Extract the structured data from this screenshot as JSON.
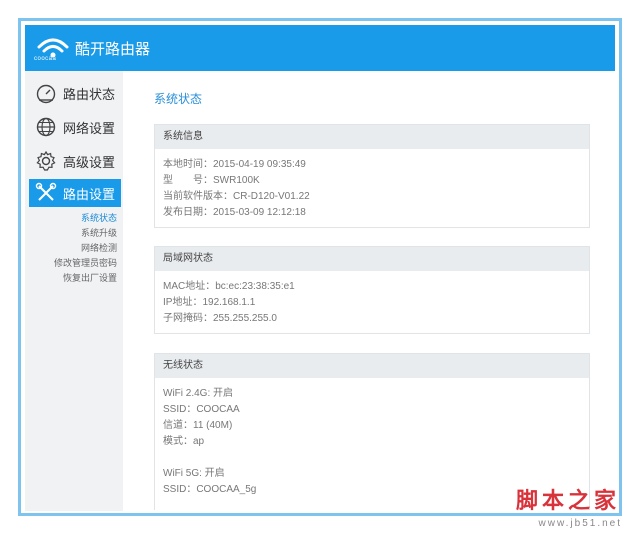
{
  "header": {
    "app_title": "酷开路由器",
    "logo_text": "coocaa"
  },
  "sidebar": {
    "items": [
      {
        "label": "路由状态",
        "icon": "gauge-icon"
      },
      {
        "label": "网络设置",
        "icon": "globe-icon"
      },
      {
        "label": "高级设置",
        "icon": "gear-icon"
      },
      {
        "label": "路由设置",
        "icon": "tools-icon"
      }
    ],
    "sub_items": [
      "系统状态",
      "系统升级",
      "网络检测",
      "修改管理员密码",
      "恢复出厂设置"
    ]
  },
  "main": {
    "page_title": "系统状态",
    "panels": [
      {
        "title": "系统信息",
        "lines": [
          "本地时间：2015-04-19 09:35:49",
          "型　　号：SWR100K",
          "当前软件版本：CR-D120-V01.22",
          "发布日期：2015-03-09 12:12:18"
        ]
      },
      {
        "title": "局域网状态",
        "lines": [
          "MAC地址：bc:ec:23:38:35:e1",
          "IP地址：192.168.1.1",
          "子网掩码：255.255.255.0"
        ]
      },
      {
        "title": "无线状态",
        "lines": [
          "WiFi 2.4G: 开启",
          "SSID：COOCAA",
          "信道：11 (40M)",
          "模式：ap",
          "WiFi 5G: 开启",
          "SSID：COOCAA_5g"
        ]
      }
    ]
  },
  "watermark": {
    "text": "脚本之家",
    "url": "www.jb51.net"
  },
  "colors": {
    "accent": "#1a9bea",
    "frame_border": "#7fc4ef",
    "panel_header": "#e9ecef",
    "sidebar_bg": "#f0f2f4"
  }
}
